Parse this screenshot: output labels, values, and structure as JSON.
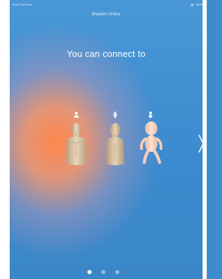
{
  "status_bar": {
    "time_date": "10:14  Tue 8 Nov",
    "battery": "100%",
    "wifi_icon": "wifi-icon"
  },
  "header": {
    "app_title": "Brayden Online"
  },
  "main": {
    "heading": "You can connect to",
    "manikins": [
      {
        "name": "adult-manikin",
        "badge_icon": "adult-person-icon"
      },
      {
        "name": "child-manikin",
        "badge_icon": "child-person-icon"
      },
      {
        "name": "baby-manikin",
        "badge_icon": "baby-person-icon"
      }
    ],
    "next_icon": "chevron-right-icon"
  },
  "pagination": {
    "total": 3,
    "active_index": 0
  },
  "colors": {
    "background_blue": "#3c8ccf",
    "glow_orange": "#ff874b",
    "text": "#ffffff"
  }
}
